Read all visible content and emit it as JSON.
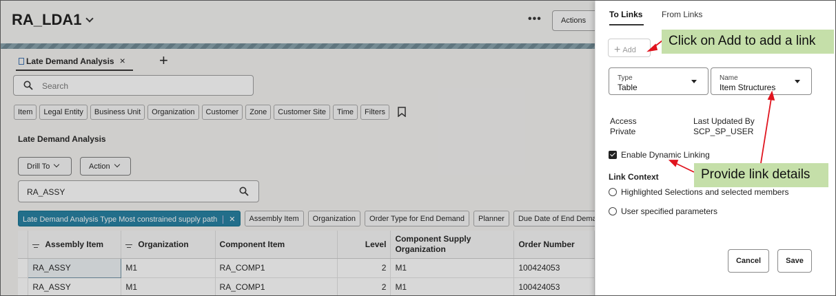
{
  "app": {
    "title": "RA_LDA1",
    "more": "•••",
    "actions_label": "Actions",
    "tab_label": "Late Demand Analysis",
    "tab_close": "×",
    "tab_add": "+",
    "search_placeholder": "Search",
    "filters": [
      "Item",
      "Legal Entity",
      "Business Unit",
      "Organization",
      "Customer",
      "Zone",
      "Customer Site",
      "Time",
      "Filters"
    ],
    "section_title": "Late Demand Analysis",
    "drill_to": "Drill To",
    "action": "Action",
    "assy_search_value": "RA_ASSY",
    "facet_selected": "Late Demand Analysis Type Most constrained supply path",
    "facet_close": "✕",
    "facets": [
      "Assembly Item",
      "Organization",
      "Order Type for End Demand",
      "Planner",
      "Due Date of End Dema"
    ],
    "table": {
      "columns": [
        "Assembly Item",
        "Organization",
        "Component Item",
        "Level",
        "Component Supply Organization",
        "Order Number"
      ],
      "rows": [
        [
          "RA_ASSY",
          "M1",
          "RA_COMP1",
          "2",
          "M1",
          "100424053"
        ],
        [
          "RA_ASSY",
          "M1",
          "RA_COMP1",
          "2",
          "M1",
          "100424053"
        ]
      ]
    }
  },
  "drawer": {
    "tabs": [
      "To Links",
      "From Links"
    ],
    "active_tab": "To Links",
    "add_label": "Add",
    "type_label": "Type",
    "type_value": "Table",
    "name_label": "Name",
    "name_value": "Item Structures",
    "access_label": "Access",
    "access_value": "Private",
    "updated_label": "Last Updated By",
    "updated_value": "SCP_SP_USER",
    "dynamic_linking": "Enable Dynamic Linking",
    "dynamic_linking_checked": true,
    "link_context_title": "Link Context",
    "link_context_options": [
      "Highlighted Selections and selected members",
      "User specified parameters"
    ],
    "cancel_label": "Cancel",
    "save_label": "Save"
  },
  "callouts": {
    "add": "Click on Add to add a link",
    "details": "Provide link details",
    "color": "#c5dfa9",
    "arrow_color": "#e0141e"
  }
}
